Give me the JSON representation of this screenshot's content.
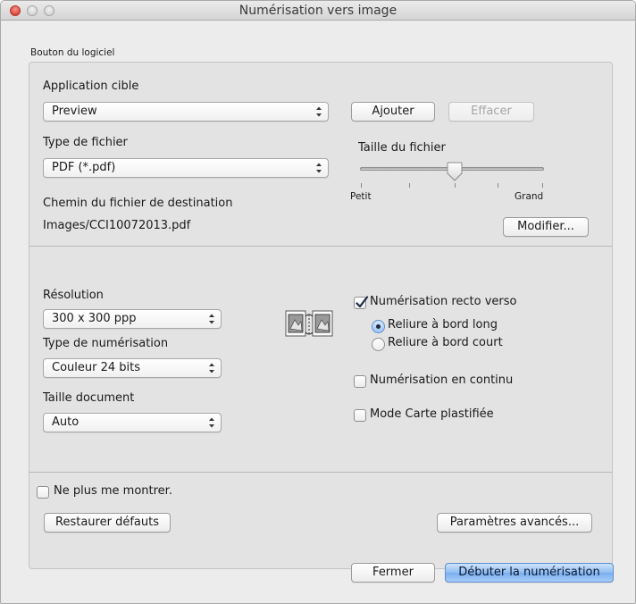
{
  "window": {
    "title": "Numérisation vers image"
  },
  "group": {
    "title": "Bouton du logiciel"
  },
  "target_app": {
    "label": "Application cible",
    "value": "Preview",
    "add_button": "Ajouter",
    "delete_button": "Effacer"
  },
  "file_type": {
    "label": "Type de fichier",
    "value": "PDF (*.pdf)"
  },
  "file_size": {
    "label": "Taille du fichier",
    "min_label": "Petit",
    "max_label": "Grand",
    "level": 0.5
  },
  "destination": {
    "label": "Chemin du fichier de destination",
    "path": "Images/CCI10072013.pdf",
    "modify_button": "Modifier..."
  },
  "resolution": {
    "label": "Résolution",
    "value": "300 x 300 ppp"
  },
  "scan_type": {
    "label": "Type de numérisation",
    "value": "Couleur 24 bits"
  },
  "document_size": {
    "label": "Taille document",
    "value": "Auto"
  },
  "duplex": {
    "label": "Numérisation recto verso",
    "checked": true,
    "options": [
      {
        "label": "Reliure à bord long",
        "selected": true
      },
      {
        "label": "Reliure à bord court",
        "selected": false
      }
    ]
  },
  "continuous_scan": {
    "label": "Numérisation en continu",
    "checked": false
  },
  "plastic_card": {
    "label": "Mode Carte plastifiée",
    "checked": false
  },
  "dont_show": {
    "label": "Ne plus me montrer.",
    "checked": false
  },
  "buttons": {
    "restore": "Restaurer défauts",
    "advanced": "Paramètres avancés...",
    "close": "Fermer",
    "start": "Débuter la numérisation"
  },
  "colors": {
    "primary_button": "#8fbdf2",
    "close_light": "#d9493b",
    "check_mark": "#1b2b44"
  },
  "icons": [
    "close-icon",
    "minimize-icon",
    "zoom-icon",
    "popup-arrows-icon",
    "duplex-scan-icon",
    "checkmark-icon",
    "slider-thumb-icon"
  ]
}
